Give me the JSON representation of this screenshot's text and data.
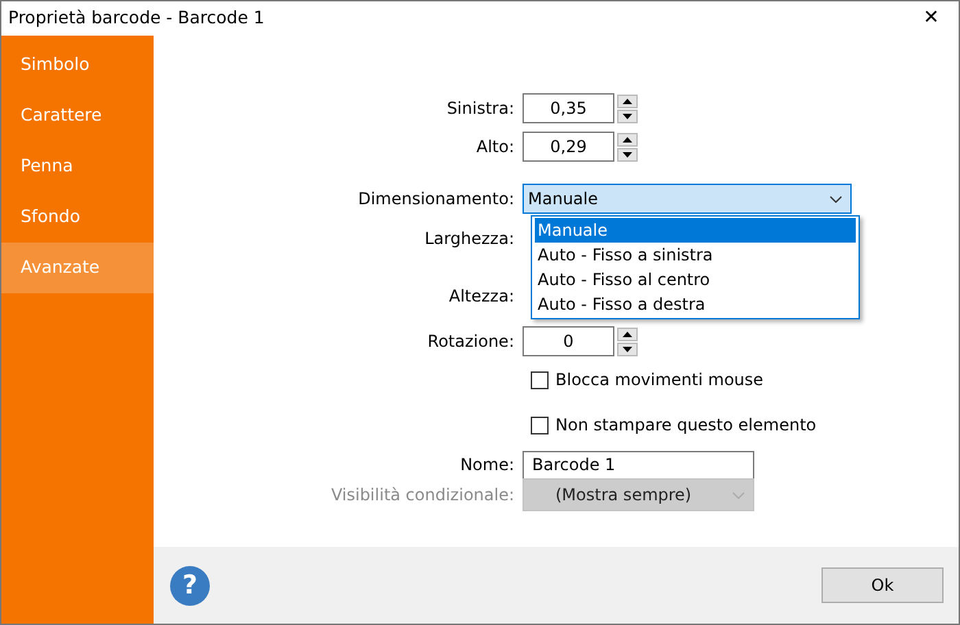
{
  "window": {
    "title": "Proprietà barcode - Barcode 1",
    "close": "✕"
  },
  "sidebar": {
    "items": [
      {
        "label": "Simbolo",
        "selected": false
      },
      {
        "label": "Carattere",
        "selected": false
      },
      {
        "label": "Penna",
        "selected": false
      },
      {
        "label": "Sfondo",
        "selected": false
      },
      {
        "label": "Avanzate",
        "selected": true
      }
    ]
  },
  "form": [
    {
      "kind": "spin",
      "label": "Sinistra:",
      "value": "0,35"
    },
    {
      "kind": "spin",
      "label": "Alto:",
      "value": "0,29"
    },
    {
      "kind": "combo",
      "label": "Dimensionamento:",
      "value": "Manuale",
      "options": [
        {
          "label": "Manuale",
          "selected": true
        },
        {
          "label": "Auto - Fisso a sinistra",
          "selected": false
        },
        {
          "label": "Auto - Fisso al centro",
          "selected": false
        },
        {
          "label": "Auto - Fisso a destra",
          "selected": false
        }
      ]
    },
    {
      "kind": "label",
      "label": "Larghezza:"
    },
    {
      "kind": "label",
      "label": "Altezza:"
    },
    {
      "kind": "spin",
      "label": "Rotazione:",
      "value": "0"
    },
    {
      "kind": "checkbox",
      "label": "Blocca movimenti mouse",
      "checked": false
    },
    {
      "kind": "checkbox",
      "label": "Non stampare questo elemento",
      "checked": false
    },
    {
      "kind": "text",
      "label": "Nome:",
      "value": "Barcode 1"
    },
    {
      "kind": "select",
      "label": "Visibilità condizionale:",
      "value": "(Mostra sempre)",
      "disabled": true
    }
  ],
  "footer": {
    "help": "?",
    "ok": "Ok"
  }
}
